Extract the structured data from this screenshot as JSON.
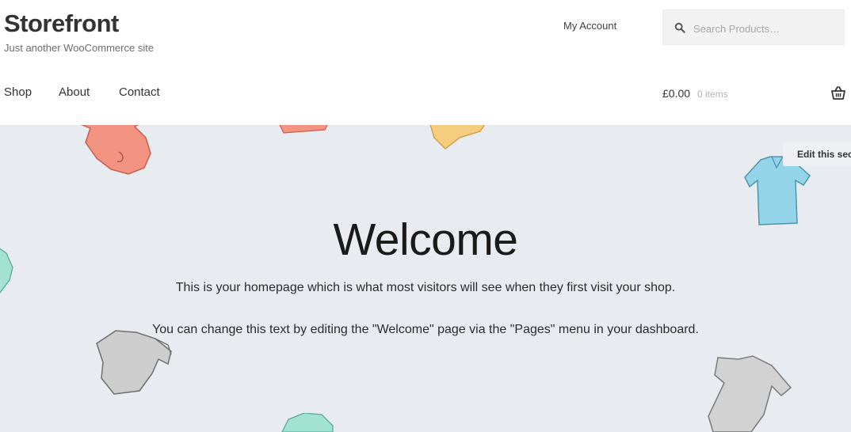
{
  "header": {
    "site_title": "Storefront",
    "site_description": "Just another WooCommerce site",
    "account_link": "My Account",
    "search": {
      "placeholder": "Search Products…",
      "value": ""
    },
    "nav": [
      "Shop",
      "About",
      "Contact"
    ],
    "cart": {
      "amount": "£0.00",
      "items": "0 items"
    }
  },
  "hero": {
    "title": "Welcome",
    "paragraph_1": "This is your homepage which is what most visitors will see when they first visit your shop.",
    "paragraph_2": "You can change this text by editing the \"Welcome\" page via the \"Pages\" menu in your dashboard.",
    "edit_button": "Edit this section"
  },
  "icons": [
    "search-icon",
    "basket-icon"
  ],
  "colors": {
    "hero_bg": "#e8ecf1",
    "accent_coral": "#f08a78",
    "accent_yellow": "#f5c877",
    "accent_blue": "#8fd3e8",
    "accent_mint": "#9fe0cf",
    "accent_grey": "#c9c9c9"
  }
}
